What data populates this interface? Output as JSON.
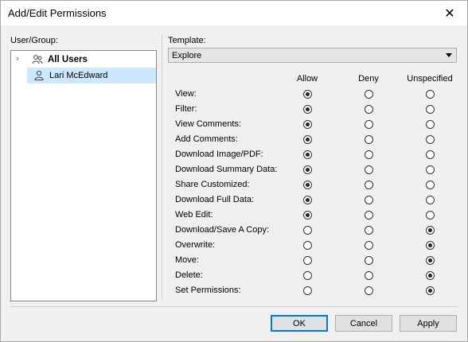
{
  "window": {
    "title": "Add/Edit Permissions"
  },
  "left": {
    "label": "User/Group:",
    "items": [
      {
        "label": "All Users",
        "icon": "users-icon",
        "bold": true,
        "expandable": true
      },
      {
        "label": "Lari McEdward",
        "icon": "user-icon",
        "selected": true
      }
    ]
  },
  "right": {
    "template_label": "Template:",
    "template_value": "Explore",
    "columns": [
      "Allow",
      "Deny",
      "Unspecified"
    ],
    "permissions": [
      {
        "label": "View:",
        "value": "Allow"
      },
      {
        "label": "Filter:",
        "value": "Allow"
      },
      {
        "label": "View Comments:",
        "value": "Allow"
      },
      {
        "label": "Add Comments:",
        "value": "Allow"
      },
      {
        "label": "Download Image/PDF:",
        "value": "Allow"
      },
      {
        "label": "Download Summary Data:",
        "value": "Allow"
      },
      {
        "label": "Share Customized:",
        "value": "Allow"
      },
      {
        "label": "Download Full Data:",
        "value": "Allow"
      },
      {
        "label": "Web Edit:",
        "value": "Allow"
      },
      {
        "label": "Download/Save A Copy:",
        "value": "Unspecified"
      },
      {
        "label": "Overwrite:",
        "value": "Unspecified"
      },
      {
        "label": "Move:",
        "value": "Unspecified"
      },
      {
        "label": "Delete:",
        "value": "Unspecified"
      },
      {
        "label": "Set Permissions:",
        "value": "Unspecified"
      }
    ]
  },
  "buttons": {
    "ok": "OK",
    "cancel": "Cancel",
    "apply": "Apply"
  }
}
